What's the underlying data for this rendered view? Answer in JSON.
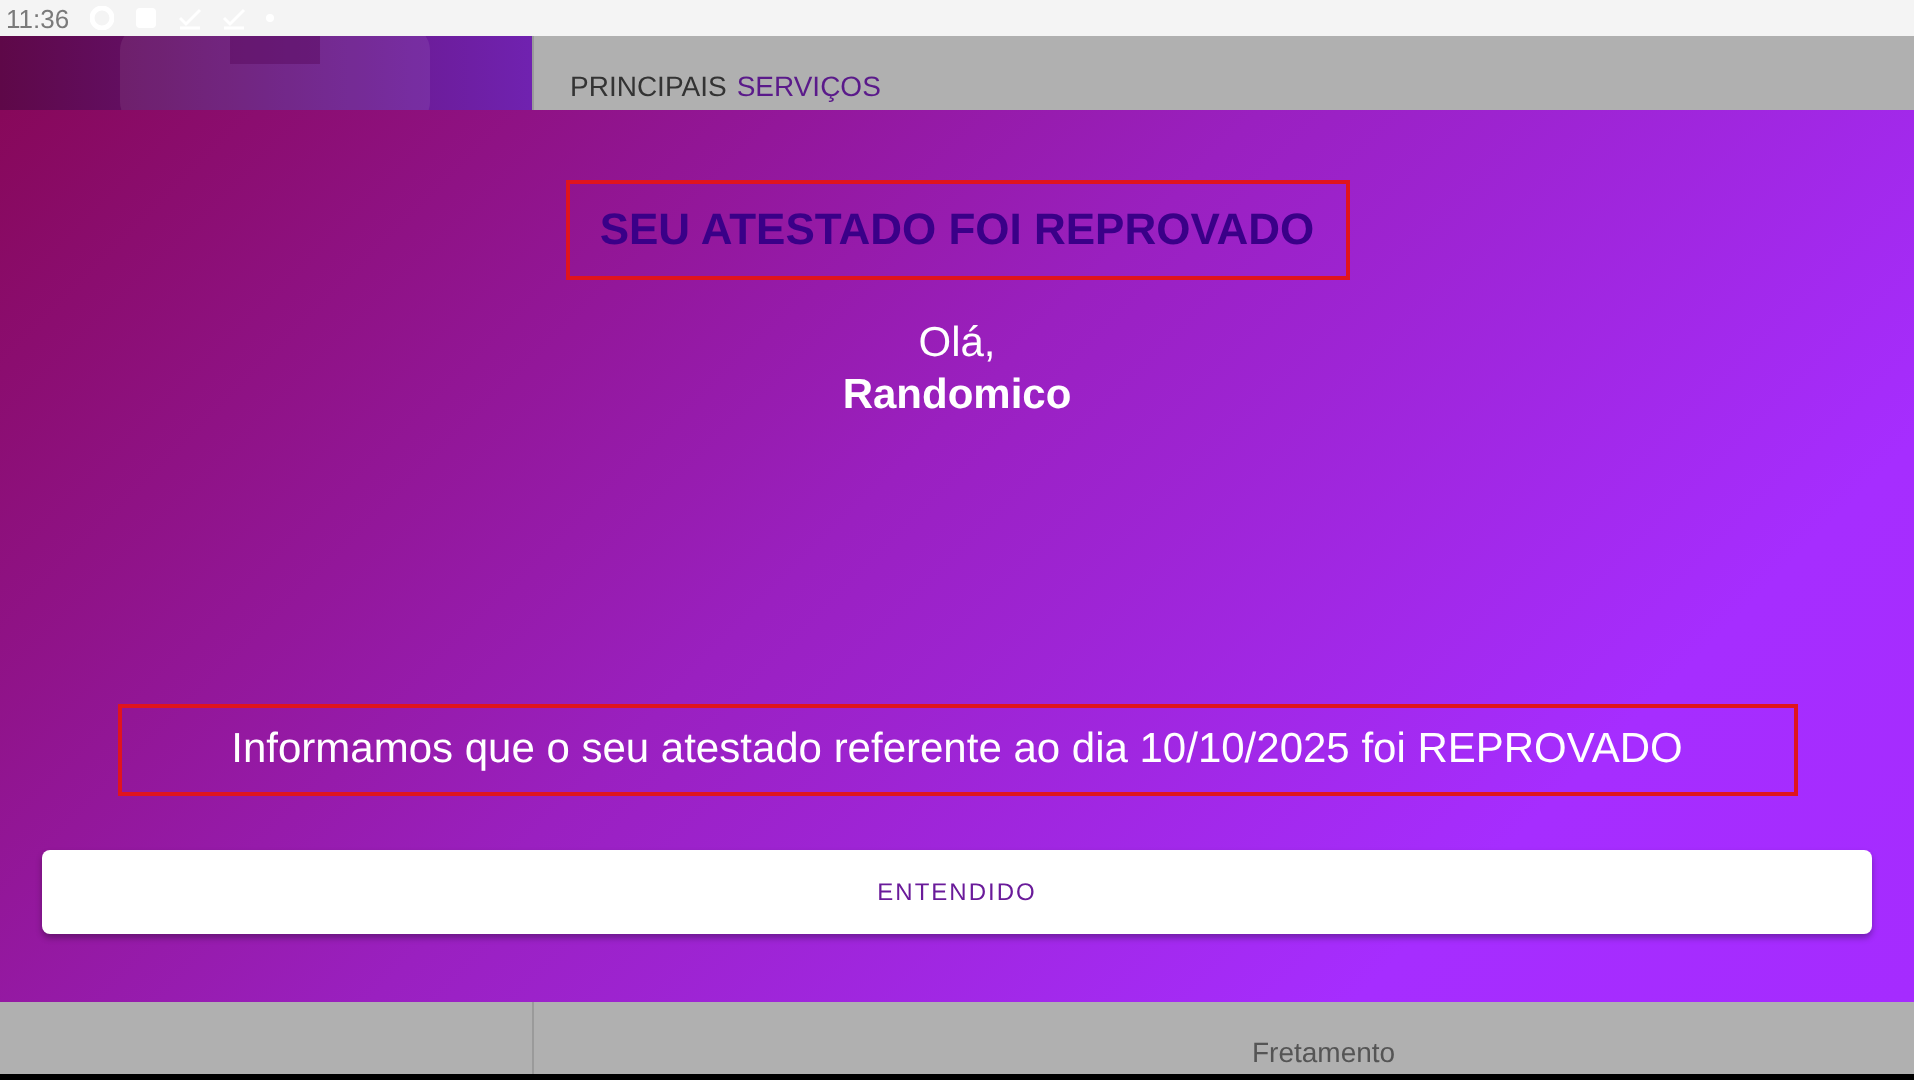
{
  "status_bar": {
    "time": "11:36"
  },
  "header": {
    "title": "PRINCIPAIS",
    "title_highlight": "SERVIÇOS"
  },
  "services": [
    {
      "label": "Fretamento"
    }
  ],
  "dialog": {
    "title": "SEU ATESTADO FOI REPROVADO",
    "title_marked": true,
    "greeting": "Olá,",
    "name": "Randomico",
    "message": "Informamos que o seu atestado referente ao dia 10/10/2025 foi REPROVADO",
    "message_marked": true,
    "button": "ENTENDIDO"
  }
}
